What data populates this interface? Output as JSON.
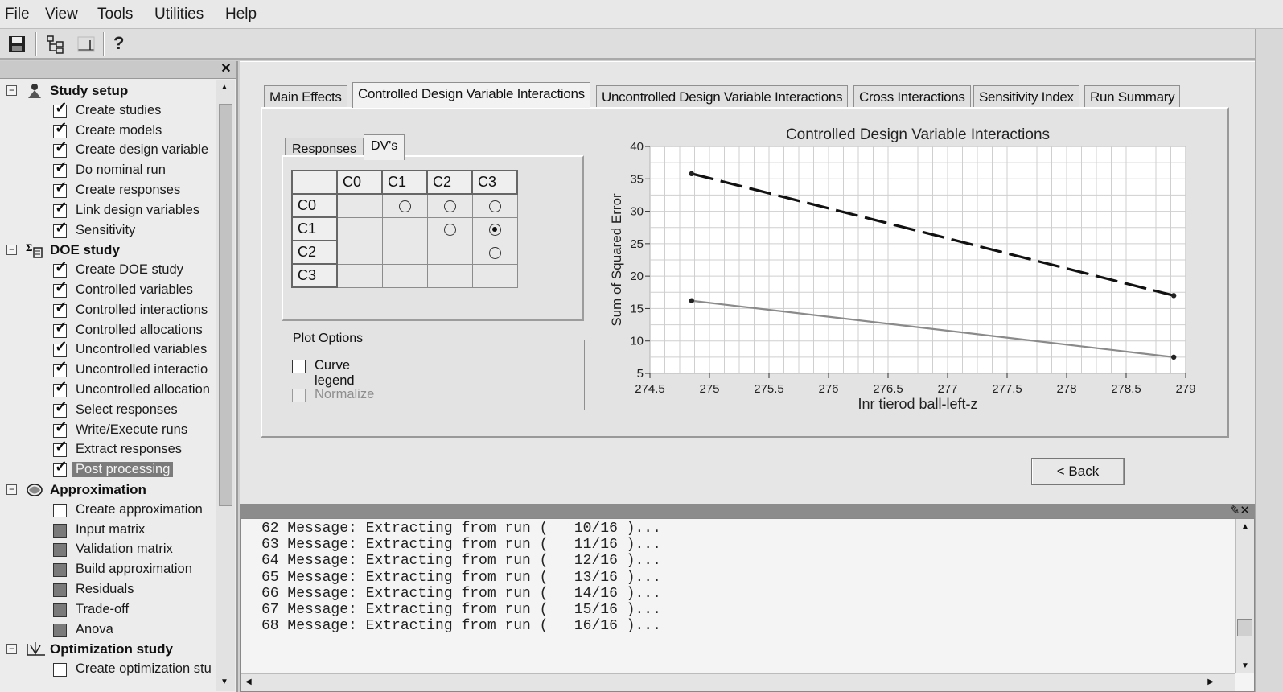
{
  "menu": {
    "file": "File",
    "view": "View",
    "tools": "Tools",
    "utilities": "Utilities",
    "help": "Help"
  },
  "toolbar": {
    "icons": [
      "save-icon",
      "tree-view-icon",
      "graph-icon",
      "help-icon"
    ]
  },
  "tree": {
    "groups": [
      {
        "label": "Study setup",
        "icon": "study-setup-icon",
        "items": [
          {
            "label": "Create studies",
            "checked": true
          },
          {
            "label": "Create models",
            "checked": true
          },
          {
            "label": "Create design variable",
            "checked": true
          },
          {
            "label": "Do nominal run",
            "checked": true
          },
          {
            "label": "Create responses",
            "checked": true
          },
          {
            "label": "Link design variables",
            "checked": true
          },
          {
            "label": "Sensitivity",
            "checked": true
          }
        ]
      },
      {
        "label": "DOE study",
        "icon": "doe-study-icon",
        "items": [
          {
            "label": "Create DOE study",
            "checked": true
          },
          {
            "label": "Controlled variables",
            "checked": true
          },
          {
            "label": "Controlled interactions",
            "checked": true
          },
          {
            "label": "Controlled allocations",
            "checked": true
          },
          {
            "label": "Uncontrolled variables",
            "checked": true
          },
          {
            "label": "Uncontrolled interactio",
            "checked": true
          },
          {
            "label": "Uncontrolled allocation",
            "checked": true
          },
          {
            "label": "Select responses",
            "checked": true
          },
          {
            "label": "Write/Execute runs",
            "checked": true
          },
          {
            "label": "Extract responses",
            "checked": true
          },
          {
            "label": "Post processing",
            "checked": true,
            "selected": true
          }
        ]
      },
      {
        "label": "Approximation",
        "icon": "approximation-icon",
        "items": [
          {
            "label": "Create approximation",
            "checked": false
          },
          {
            "label": "Input matrix",
            "checked": false,
            "filled": true
          },
          {
            "label": "Validation matrix",
            "checked": false,
            "filled": true
          },
          {
            "label": "Build approximation",
            "checked": false,
            "filled": true
          },
          {
            "label": "Residuals",
            "checked": false,
            "filled": true
          },
          {
            "label": "Trade-off",
            "checked": false,
            "filled": true
          },
          {
            "label": "Anova",
            "checked": false,
            "filled": true
          }
        ]
      },
      {
        "label": "Optimization study",
        "icon": "optimization-icon",
        "items": [
          {
            "label": "Create optimization stu",
            "checked": false
          }
        ]
      }
    ]
  },
  "tabs": [
    {
      "label": "Main Effects"
    },
    {
      "label": "Controlled Design Variable Interactions",
      "active": true
    },
    {
      "label": "Uncontrolled Design Variable Interactions"
    },
    {
      "label": "Cross Interactions"
    },
    {
      "label": "Sensitivity Index"
    },
    {
      "label": "Run Summary"
    }
  ],
  "subtabs": {
    "responses": "Responses",
    "dvs": "DV's"
  },
  "matrix": {
    "headers": [
      "C0",
      "C1",
      "C2",
      "C3"
    ],
    "rows": [
      {
        "label": "C0",
        "cells": [
          "",
          "radio",
          "radio",
          "radio"
        ]
      },
      {
        "label": "C1",
        "cells": [
          "",
          "",
          "radio",
          "radio-on"
        ]
      },
      {
        "label": "C2",
        "cells": [
          "",
          "",
          "",
          "radio"
        ]
      },
      {
        "label": "C3",
        "cells": [
          "",
          "",
          "",
          ""
        ]
      }
    ]
  },
  "plot_options": {
    "title": "Plot Options",
    "curve_legend": "Curve legend",
    "normalize": "Normalize"
  },
  "chart_data": {
    "type": "line",
    "title": "Controlled Design Variable Interactions",
    "xlabel": "Inr tierod ball-left-z",
    "ylabel": "Sum of Squared Error",
    "xlim": [
      274.5,
      279
    ],
    "ylim": [
      5,
      40
    ],
    "xticks": [
      "274.5",
      "275",
      "275.5",
      "276",
      "276.5",
      "277",
      "277.5",
      "278",
      "278.5",
      "279"
    ],
    "yticks": [
      "5",
      "10",
      "15",
      "20",
      "25",
      "30",
      "35",
      "40"
    ],
    "grid": true,
    "series": [
      {
        "style": "dashed",
        "color": "#111111",
        "x": [
          274.85,
          278.9
        ],
        "y": [
          35.8,
          17.0
        ]
      },
      {
        "style": "solid",
        "color": "#8a8a8a",
        "x": [
          274.85,
          278.9
        ],
        "y": [
          16.2,
          7.5
        ]
      }
    ]
  },
  "back_button": {
    "label": "< Back"
  },
  "messages": [
    "62 Message: Extracting from run (   10/16 )...",
    "63 Message: Extracting from run (   11/16 )...",
    "64 Message: Extracting from run (   12/16 )...",
    "65 Message: Extracting from run (   13/16 )...",
    "66 Message: Extracting from run (   14/16 )...",
    "67 Message: Extracting from run (   15/16 )...",
    "68 Message: Extracting from run (   16/16 )..."
  ]
}
